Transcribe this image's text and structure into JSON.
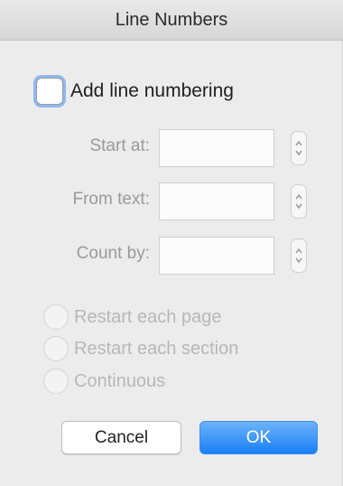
{
  "window": {
    "title": "Line Numbers"
  },
  "add_line_numbering": {
    "label": "Add line numbering",
    "checked": false
  },
  "fields": [
    {
      "label": "Start at:",
      "value": ""
    },
    {
      "label": "From text:",
      "value": ""
    },
    {
      "label": "Count by:",
      "value": ""
    }
  ],
  "restart_options": [
    {
      "label": "Restart each page",
      "selected": false
    },
    {
      "label": "Restart each section",
      "selected": false
    },
    {
      "label": "Continuous",
      "selected": false
    }
  ],
  "buttons": {
    "cancel_label": "Cancel",
    "ok_label": "OK"
  },
  "colors": {
    "accent": "#1a7ff6",
    "focus_ring": "#8fb8ef",
    "disabled_text": "#b7b7b7"
  }
}
